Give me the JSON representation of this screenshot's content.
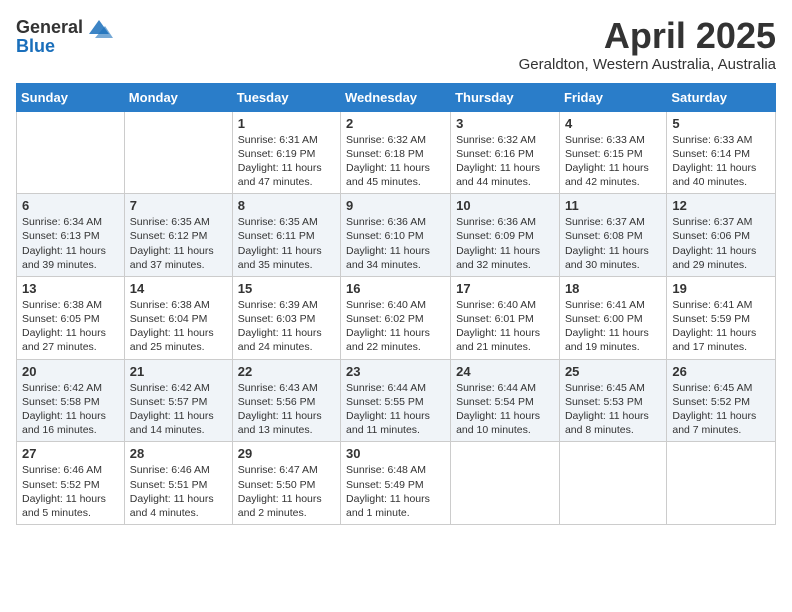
{
  "header": {
    "logo_general": "General",
    "logo_blue": "Blue",
    "month_title": "April 2025",
    "subtitle": "Geraldton, Western Australia, Australia"
  },
  "days_of_week": [
    "Sunday",
    "Monday",
    "Tuesday",
    "Wednesday",
    "Thursday",
    "Friday",
    "Saturday"
  ],
  "weeks": [
    [
      {
        "num": "",
        "detail": ""
      },
      {
        "num": "",
        "detail": ""
      },
      {
        "num": "1",
        "detail": "Sunrise: 6:31 AM\nSunset: 6:19 PM\nDaylight: 11 hours and 47 minutes."
      },
      {
        "num": "2",
        "detail": "Sunrise: 6:32 AM\nSunset: 6:18 PM\nDaylight: 11 hours and 45 minutes."
      },
      {
        "num": "3",
        "detail": "Sunrise: 6:32 AM\nSunset: 6:16 PM\nDaylight: 11 hours and 44 minutes."
      },
      {
        "num": "4",
        "detail": "Sunrise: 6:33 AM\nSunset: 6:15 PM\nDaylight: 11 hours and 42 minutes."
      },
      {
        "num": "5",
        "detail": "Sunrise: 6:33 AM\nSunset: 6:14 PM\nDaylight: 11 hours and 40 minutes."
      }
    ],
    [
      {
        "num": "6",
        "detail": "Sunrise: 6:34 AM\nSunset: 6:13 PM\nDaylight: 11 hours and 39 minutes."
      },
      {
        "num": "7",
        "detail": "Sunrise: 6:35 AM\nSunset: 6:12 PM\nDaylight: 11 hours and 37 minutes."
      },
      {
        "num": "8",
        "detail": "Sunrise: 6:35 AM\nSunset: 6:11 PM\nDaylight: 11 hours and 35 minutes."
      },
      {
        "num": "9",
        "detail": "Sunrise: 6:36 AM\nSunset: 6:10 PM\nDaylight: 11 hours and 34 minutes."
      },
      {
        "num": "10",
        "detail": "Sunrise: 6:36 AM\nSunset: 6:09 PM\nDaylight: 11 hours and 32 minutes."
      },
      {
        "num": "11",
        "detail": "Sunrise: 6:37 AM\nSunset: 6:08 PM\nDaylight: 11 hours and 30 minutes."
      },
      {
        "num": "12",
        "detail": "Sunrise: 6:37 AM\nSunset: 6:06 PM\nDaylight: 11 hours and 29 minutes."
      }
    ],
    [
      {
        "num": "13",
        "detail": "Sunrise: 6:38 AM\nSunset: 6:05 PM\nDaylight: 11 hours and 27 minutes."
      },
      {
        "num": "14",
        "detail": "Sunrise: 6:38 AM\nSunset: 6:04 PM\nDaylight: 11 hours and 25 minutes."
      },
      {
        "num": "15",
        "detail": "Sunrise: 6:39 AM\nSunset: 6:03 PM\nDaylight: 11 hours and 24 minutes."
      },
      {
        "num": "16",
        "detail": "Sunrise: 6:40 AM\nSunset: 6:02 PM\nDaylight: 11 hours and 22 minutes."
      },
      {
        "num": "17",
        "detail": "Sunrise: 6:40 AM\nSunset: 6:01 PM\nDaylight: 11 hours and 21 minutes."
      },
      {
        "num": "18",
        "detail": "Sunrise: 6:41 AM\nSunset: 6:00 PM\nDaylight: 11 hours and 19 minutes."
      },
      {
        "num": "19",
        "detail": "Sunrise: 6:41 AM\nSunset: 5:59 PM\nDaylight: 11 hours and 17 minutes."
      }
    ],
    [
      {
        "num": "20",
        "detail": "Sunrise: 6:42 AM\nSunset: 5:58 PM\nDaylight: 11 hours and 16 minutes."
      },
      {
        "num": "21",
        "detail": "Sunrise: 6:42 AM\nSunset: 5:57 PM\nDaylight: 11 hours and 14 minutes."
      },
      {
        "num": "22",
        "detail": "Sunrise: 6:43 AM\nSunset: 5:56 PM\nDaylight: 11 hours and 13 minutes."
      },
      {
        "num": "23",
        "detail": "Sunrise: 6:44 AM\nSunset: 5:55 PM\nDaylight: 11 hours and 11 minutes."
      },
      {
        "num": "24",
        "detail": "Sunrise: 6:44 AM\nSunset: 5:54 PM\nDaylight: 11 hours and 10 minutes."
      },
      {
        "num": "25",
        "detail": "Sunrise: 6:45 AM\nSunset: 5:53 PM\nDaylight: 11 hours and 8 minutes."
      },
      {
        "num": "26",
        "detail": "Sunrise: 6:45 AM\nSunset: 5:52 PM\nDaylight: 11 hours and 7 minutes."
      }
    ],
    [
      {
        "num": "27",
        "detail": "Sunrise: 6:46 AM\nSunset: 5:52 PM\nDaylight: 11 hours and 5 minutes."
      },
      {
        "num": "28",
        "detail": "Sunrise: 6:46 AM\nSunset: 5:51 PM\nDaylight: 11 hours and 4 minutes."
      },
      {
        "num": "29",
        "detail": "Sunrise: 6:47 AM\nSunset: 5:50 PM\nDaylight: 11 hours and 2 minutes."
      },
      {
        "num": "30",
        "detail": "Sunrise: 6:48 AM\nSunset: 5:49 PM\nDaylight: 11 hours and 1 minute."
      },
      {
        "num": "",
        "detail": ""
      },
      {
        "num": "",
        "detail": ""
      },
      {
        "num": "",
        "detail": ""
      }
    ]
  ]
}
